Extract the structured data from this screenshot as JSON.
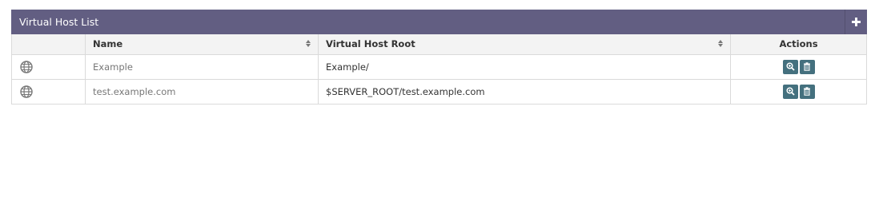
{
  "panel": {
    "title": "Virtual Host List",
    "add_icon": "plus-icon"
  },
  "table": {
    "columns": [
      "",
      "Name",
      "Virtual Host Root",
      "Actions"
    ],
    "rows": [
      {
        "icon": "globe-icon",
        "name": "Example",
        "root": "Example/"
      },
      {
        "icon": "globe-icon",
        "name": "test.example.com",
        "root": "$SERVER_ROOT/test.example.com"
      }
    ],
    "row_actions": [
      "zoom-icon",
      "trash-icon"
    ]
  },
  "colors": {
    "header_bg": "#625e82",
    "action_btn": "#44707e",
    "table_header_bg": "#f3f3f3"
  }
}
